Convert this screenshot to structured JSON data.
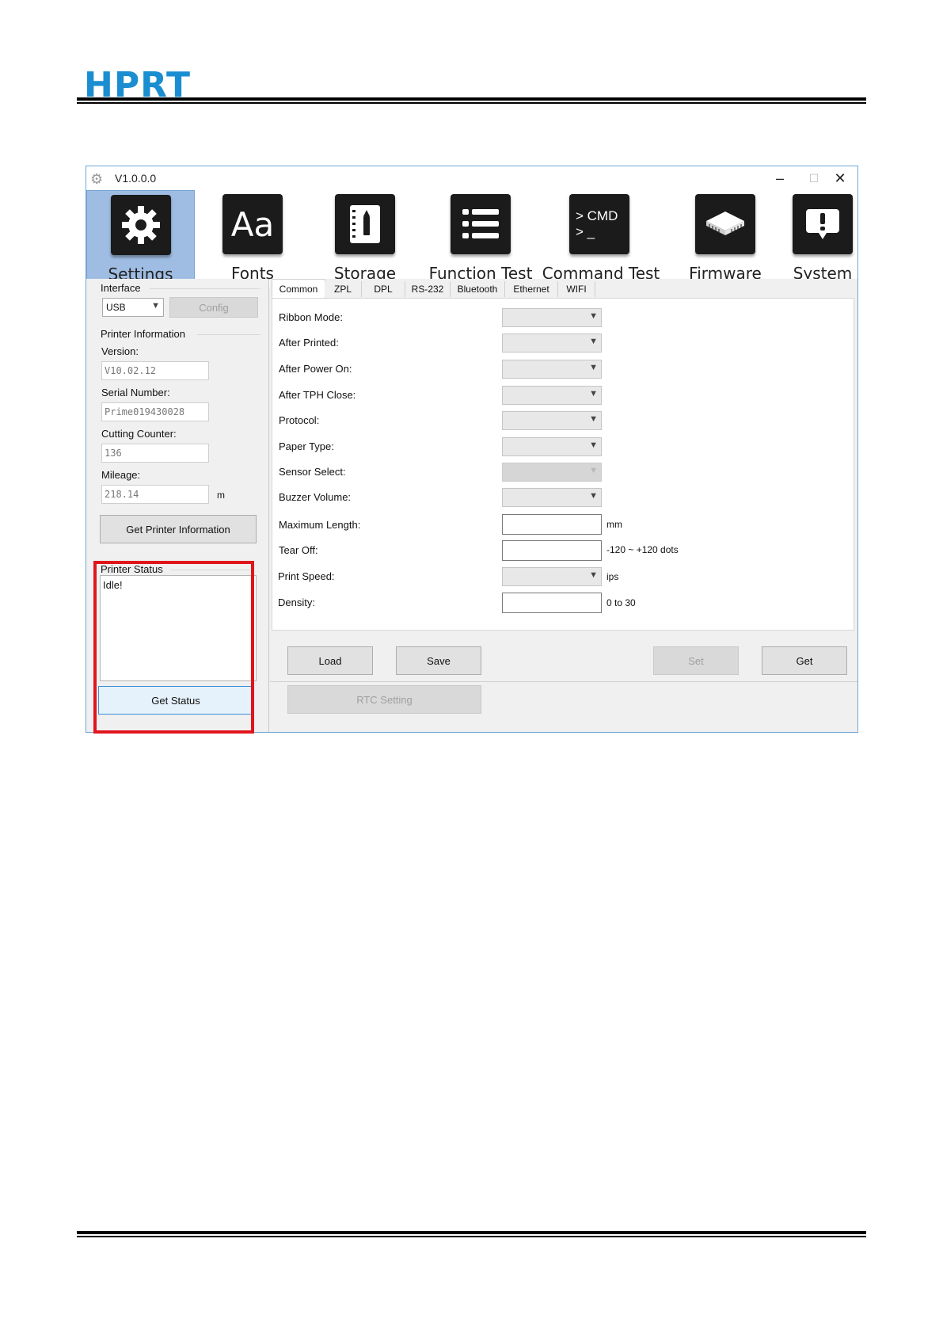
{
  "document": {
    "brand": "HPRT"
  },
  "window": {
    "title": "V1.0.0.0",
    "controls": {
      "minimize": "–",
      "maximize": "☐",
      "close": "✕"
    }
  },
  "toolbar": {
    "items": [
      {
        "label": "Settings",
        "icon": "gear-icon",
        "active": true
      },
      {
        "label": "Fonts",
        "icon": "fonts-icon",
        "glyph": "Aa"
      },
      {
        "label": "Storage",
        "icon": "storage-icon"
      },
      {
        "label": "Function Test",
        "icon": "list-icon"
      },
      {
        "label": "Command Test",
        "icon": "cmd-icon",
        "glyph1": "> CMD",
        "glyph2": "> _"
      },
      {
        "label": "Firmware",
        "icon": "chip-icon"
      },
      {
        "label": "System",
        "icon": "alert-icon",
        "glyph": "!"
      }
    ]
  },
  "left": {
    "interface": {
      "title": "Interface",
      "selected": "USB",
      "config_label": "Config"
    },
    "printer_info": {
      "title": "Printer Information",
      "version_label": "Version:",
      "version_value": "V10.02.12",
      "serial_label": "Serial Number:",
      "serial_value": "Prime019430028",
      "cutting_label": "Cutting Counter:",
      "cutting_value": "136",
      "mileage_label": "Mileage:",
      "mileage_value": "218.14",
      "mileage_unit": "m",
      "get_info_label": "Get Printer Information"
    },
    "printer_status": {
      "title": "Printer Status",
      "value": "Idle!",
      "get_status_label": "Get Status"
    }
  },
  "right": {
    "tabs": [
      "Common",
      "ZPL",
      "DPL",
      "RS-232",
      "Bluetooth",
      "Ethernet",
      "WIFI"
    ],
    "active_tab": "Common",
    "fields": {
      "ribbon_mode": "Ribbon Mode:",
      "after_printed": "After Printed:",
      "after_power_on": "After Power On:",
      "after_tph_close": "After TPH Close:",
      "protocol": "Protocol:",
      "paper_type": "Paper Type:",
      "sensor_select": "Sensor Select:",
      "buzzer_volume": "Buzzer Volume:",
      "maximum_length": "Maximum Length:",
      "tear_off": "Tear Off:",
      "print_speed": "Print Speed:",
      "density": "Density:"
    },
    "units": {
      "maximum_length": "mm",
      "tear_off": "-120 ~ +120 dots",
      "print_speed": "ips",
      "density": "0 to 30"
    },
    "buttons": {
      "load": "Load",
      "save": "Save",
      "set": "Set",
      "get": "Get",
      "rtc": "RTC Setting"
    }
  }
}
